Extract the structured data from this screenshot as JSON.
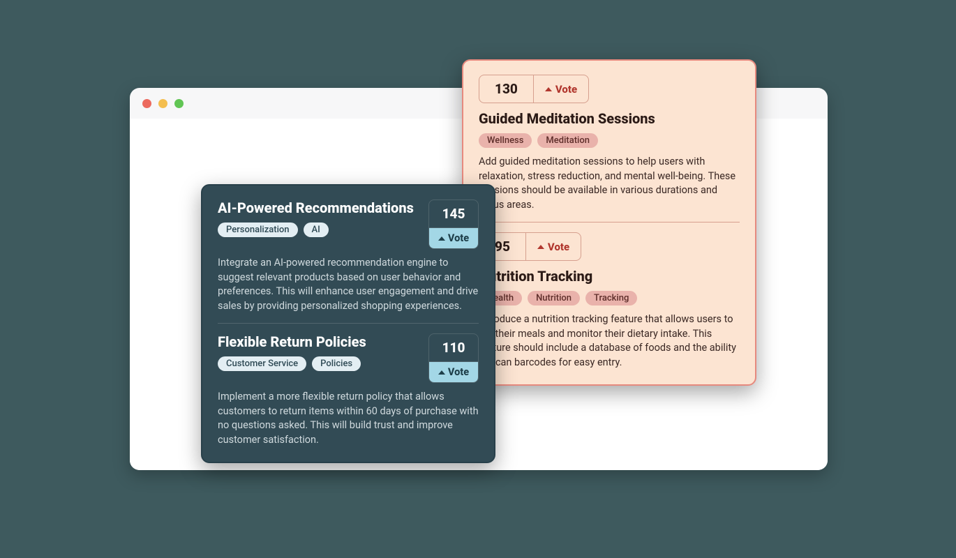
{
  "vote_label": "Vote",
  "dark_card": {
    "items": [
      {
        "title": "AI-Powered Recommendations",
        "votes": "145",
        "tags": [
          "Personalization",
          "AI"
        ],
        "desc": "Integrate an AI-powered recommendation engine to suggest relevant products based on user behavior and preferences. This will enhance user engagement and drive sales by providing personalized shopping experiences."
      },
      {
        "title": "Flexible Return Policies",
        "votes": "110",
        "tags": [
          "Customer Service",
          "Policies"
        ],
        "desc": "Implement a more flexible return policy that allows customers to return items within 60 days of purchase with no questions asked. This will build trust and improve customer satisfaction."
      }
    ]
  },
  "light_card": {
    "items": [
      {
        "title": "Guided Meditation Sessions",
        "votes": "130",
        "tags": [
          "Wellness",
          "Meditation"
        ],
        "desc": "Add guided meditation sessions to help users with relaxation, stress reduction, and mental well-being. These sessions should be available in various durations and focus areas."
      },
      {
        "title": "Nutrition Tracking",
        "votes": "95",
        "tags": [
          "Health",
          "Nutrition",
          "Tracking"
        ],
        "desc": "Introduce a nutrition tracking feature that allows users to log their meals and monitor their dietary intake. This feature should include a database of foods and the ability to scan barcodes for easy entry."
      }
    ]
  }
}
